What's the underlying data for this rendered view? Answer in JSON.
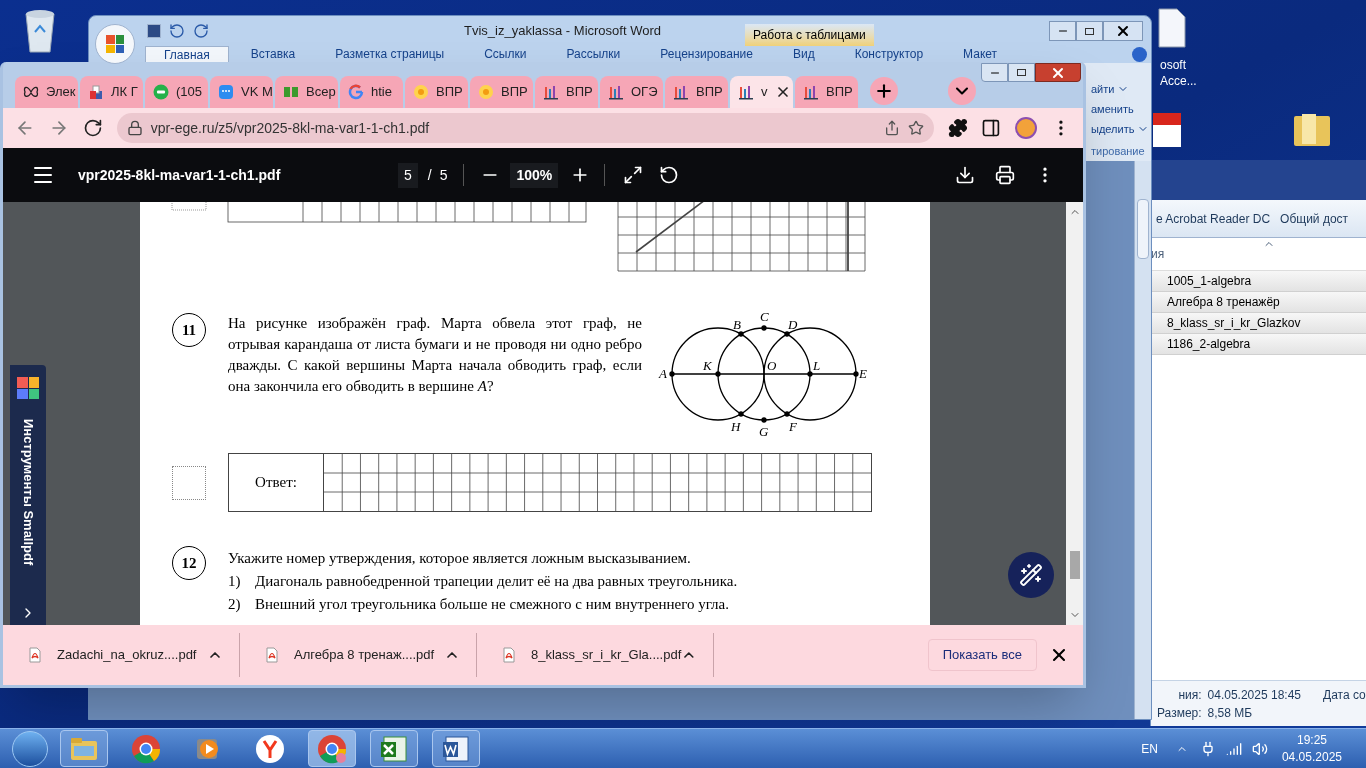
{
  "desktop": {
    "shortcut_label_lines": [
      "osoft",
      "Acce..."
    ]
  },
  "word": {
    "title": "Tvis_iz_yaklassa - Microsoft Word",
    "context_group": "Работа с таблицами",
    "ribbon_tabs": [
      {
        "label": "Главная",
        "selected": true
      },
      {
        "label": "Вставка",
        "selected": false
      },
      {
        "label": "Разметка страницы",
        "selected": false
      },
      {
        "label": "Ссылки",
        "selected": false
      },
      {
        "label": "Рассылки",
        "selected": false
      },
      {
        "label": "Рецензирование",
        "selected": false
      },
      {
        "label": "Вид",
        "selected": false
      },
      {
        "label": "Конструктор",
        "selected": false
      },
      {
        "label": "Макет",
        "selected": false
      }
    ],
    "ribbon_fragments": [
      {
        "text": "айти",
        "dropdown": true
      },
      {
        "text": "аменить",
        "dropdown": false
      },
      {
        "text": "ыделить",
        "dropdown": true
      }
    ],
    "group_label": "тирование"
  },
  "explorer": {
    "toolbar": [
      "e Acrobat Reader DC",
      "Общий дост"
    ],
    "column": "ия",
    "files": [
      "1005_1-algebra",
      "Алгебра 8 тренажёр",
      "8_klass_sr_i_kr_Glazkov",
      "1186_2-algebra"
    ],
    "details": [
      {
        "label": "ния:",
        "value": "04.05.2025 18:45"
      },
      {
        "label": "Размер:",
        "value": "8,58 МБ"
      }
    ],
    "date_label": "Дата со"
  },
  "browser": {
    "tabs": [
      {
        "kind": "butterfly",
        "title": "Элек",
        "selected": false
      },
      {
        "kind": "ballot",
        "title": "ЛК Г",
        "selected": false
      },
      {
        "kind": "chat",
        "title": "(105",
        "selected": false
      },
      {
        "kind": "vk",
        "title": "VK M",
        "selected": false
      },
      {
        "kind": "squares",
        "title": "Всер",
        "selected": false
      },
      {
        "kind": "google",
        "title": "htie",
        "selected": false
      },
      {
        "kind": "sun",
        "title": "ВПР",
        "selected": false
      },
      {
        "kind": "sun",
        "title": "ВПР",
        "selected": false
      },
      {
        "kind": "bars",
        "title": "ВПР",
        "selected": false
      },
      {
        "kind": "bars",
        "title": "ОГЭ",
        "selected": false
      },
      {
        "kind": "bars",
        "title": "ВПР",
        "selected": false
      },
      {
        "kind": "bars",
        "title": "v",
        "selected": true
      },
      {
        "kind": "bars",
        "title": "ВПР",
        "selected": false
      }
    ],
    "url": "vpr-ege.ru/z5/vpr2025-8kl-ma-var1-1-ch1.pdf",
    "pdf": {
      "filename": "vpr2025-8kl-ma-var1-1-ch1.pdf",
      "page": "5",
      "separator": "/",
      "pages": "5",
      "zoom": "100%"
    },
    "sidebar_label": "Инструменты Smallpdf",
    "document": {
      "q11": {
        "number": "11",
        "text": "На рисунке изображён граф. Марта обвела этот граф, не отрывая карандаша от листа бумаги и не проводя ни одно ребро дважды. С какой вершины Марта начала обводить граф, если она закончила его обводить в вершине *A*?",
        "vertices": [
          "A",
          "B",
          "C",
          "D",
          "K",
          "O",
          "L",
          "E",
          "H",
          "G",
          "F"
        ],
        "answer_label": "Ответ:"
      },
      "q12": {
        "number": "12",
        "text": "Укажите номер утверждения, которое является ложным высказыванием.",
        "options": [
          {
            "marker": "1)",
            "text": "Диагональ равнобедренной трапеции делит её на два равных треугольника."
          },
          {
            "marker": "2)",
            "text": "Внешний угол треугольника больше не смежного с ним внутреннего угла."
          }
        ]
      }
    },
    "downloads": {
      "items": [
        "Zadachi_na_okruz....pdf",
        "Алгебра 8 тренаж....pdf",
        "8_klass_sr_i_kr_Gla....pdf"
      ],
      "show_all": "Показать все"
    }
  },
  "taskbar": {
    "apps": [
      {
        "kind": "explorer",
        "running": true,
        "selected": false
      },
      {
        "kind": "chrome",
        "running": false,
        "selected": false
      },
      {
        "kind": "media",
        "running": false,
        "selected": false
      },
      {
        "kind": "yandex",
        "running": false,
        "selected": false
      },
      {
        "kind": "chrome-profile",
        "running": true,
        "selected": true
      },
      {
        "kind": "excel",
        "running": true,
        "selected": false
      },
      {
        "kind": "word",
        "running": true,
        "selected": false
      }
    ],
    "language": "EN",
    "time": "19:25",
    "date": "04.05.2025"
  }
}
